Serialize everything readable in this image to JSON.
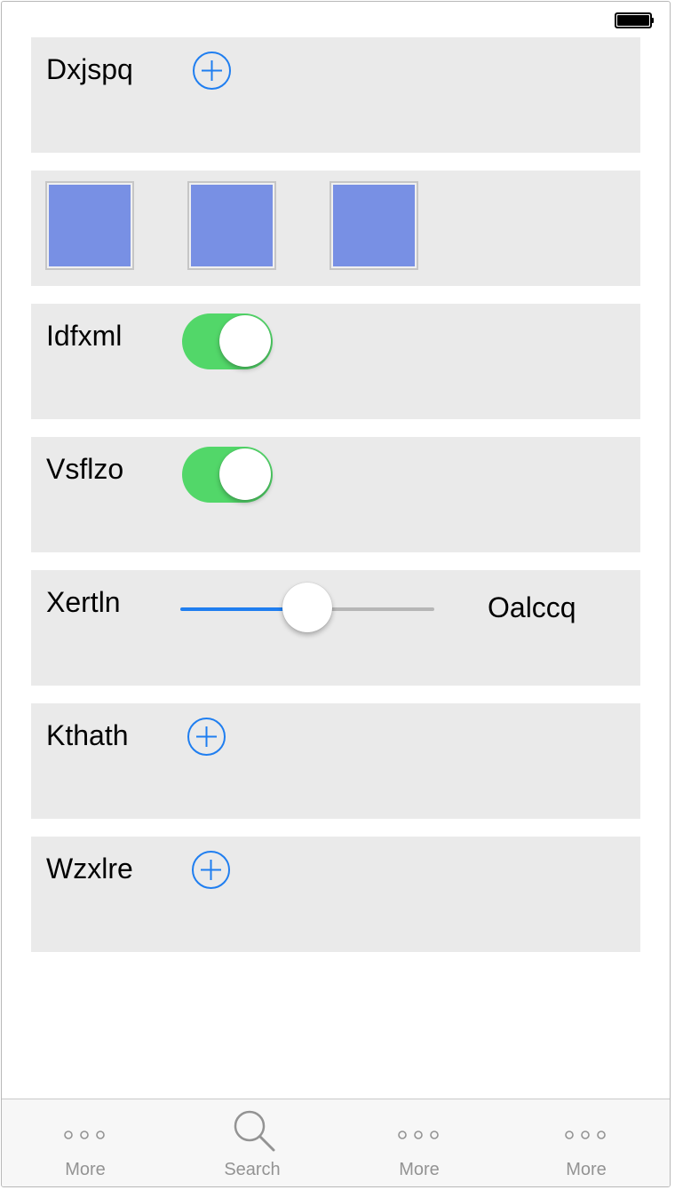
{
  "status_bar": {
    "battery_level": 1.0
  },
  "colors": {
    "accent": "#1f7ef0",
    "switch_on": "#52d769",
    "cell_background": "#eaeaea",
    "swatch": "#7890e4",
    "tab_inactive": "#939393"
  },
  "rows": {
    "dxjspq": {
      "label": "Dxjspq",
      "button_icon": "plus-circle-icon"
    },
    "images": {
      "count": 3,
      "icon": "image-swatch"
    },
    "idfxml": {
      "label": "Idfxml",
      "on": true
    },
    "vsflzo": {
      "label": "Vsflzo",
      "on": true
    },
    "xertln": {
      "label": "Xertln",
      "value_label": "Oalccq",
      "slider_fraction": 0.5
    },
    "kthath": {
      "label": "Kthath",
      "button_icon": "plus-circle-icon"
    },
    "wzxlre": {
      "label": "Wzxlre",
      "button_icon": "plus-circle-icon"
    }
  },
  "tabbar": {
    "tabs": [
      {
        "label": "More",
        "icon": "more-dots-icon"
      },
      {
        "label": "Search",
        "icon": "search-icon"
      },
      {
        "label": "More",
        "icon": "more-dots-icon"
      },
      {
        "label": "More",
        "icon": "more-dots-icon"
      }
    ]
  }
}
